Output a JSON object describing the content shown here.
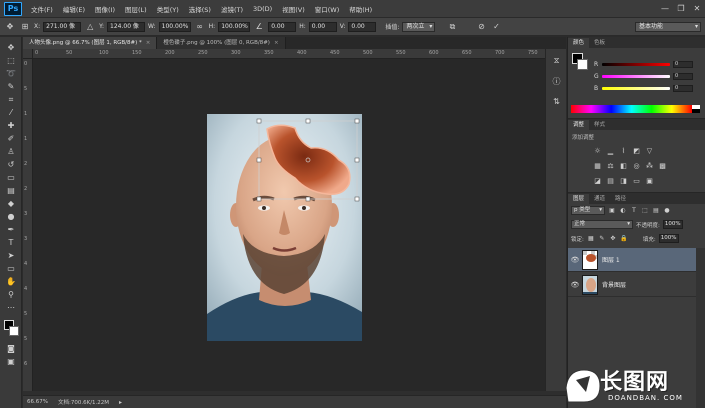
{
  "menubar": {
    "logo": "Ps",
    "items": [
      "文件(F)",
      "编辑(E)",
      "图像(I)",
      "图层(L)",
      "类型(Y)",
      "选择(S)",
      "滤镜(T)",
      "3D(D)",
      "视图(V)",
      "窗口(W)",
      "帮助(H)"
    ],
    "window_buttons": [
      "—",
      "❐",
      "✕"
    ]
  },
  "options": {
    "x_label": "X:",
    "x_value": "271.00 像",
    "y_label": "Y:",
    "y_value": "124.00 像",
    "w_label": "W:",
    "w_value": "100.00%",
    "h_label": "H:",
    "h_value": "100.00%",
    "angle_value": "0.00",
    "h_skew_label": "H:",
    "h_skew_value": "0.00",
    "v_skew_label": "V:",
    "v_skew_value": "0.00",
    "interp_label": "插值:",
    "interp_value": "两次立",
    "workspace": "基本功能"
  },
  "tabs": [
    {
      "label": "人物头像.png @ 66.7% (图层 1, RGB/8#) *",
      "active": true
    },
    {
      "label": "橙色碟子.png @ 100% (图层 0, RGB/8#)",
      "active": false
    }
  ],
  "ruler_top": [
    "0",
    "50",
    "100",
    "150",
    "200",
    "250",
    "300",
    "350",
    "400",
    "450",
    "500",
    "550",
    "600",
    "650",
    "700",
    "750"
  ],
  "ruler_left": [
    "0",
    "5",
    "1",
    "1",
    "2",
    "2",
    "3",
    "3",
    "4",
    "4",
    "5",
    "5",
    "6"
  ],
  "status": {
    "zoom": "66.67%",
    "doc": "文档:700.6K/1.22M"
  },
  "color_panel": {
    "tabs": [
      "颜色",
      "色板"
    ],
    "sliders": [
      {
        "letter": "R",
        "value": "0",
        "gradient": "linear-gradient(to right,#000,#f00)"
      },
      {
        "letter": "G",
        "value": "0",
        "gradient": "linear-gradient(to right,#f0f,#fff)"
      },
      {
        "letter": "B",
        "value": "0",
        "gradient": "linear-gradient(to right,#ff0,#fff)"
      }
    ]
  },
  "adjustments": {
    "tabs": [
      "调整",
      "样式"
    ],
    "title": "添加调整"
  },
  "layers": {
    "tabs": [
      "图层",
      "通道",
      "路径"
    ],
    "filter": "p 类型",
    "blend": "正常",
    "opacity_label": "不透明度:",
    "opacity": "100%",
    "lock_label": "锁定:",
    "fill_label": "填充:",
    "fill": "100%",
    "items": [
      {
        "name": "图层 1",
        "active": true
      },
      {
        "name": "背景图层",
        "active": false
      }
    ]
  },
  "watermark": {
    "brand": "长图网",
    "url": "DOANDBAN. COM"
  },
  "colors": {
    "accent_selected_layer": "#596779",
    "canvas_bg": "#282828"
  }
}
